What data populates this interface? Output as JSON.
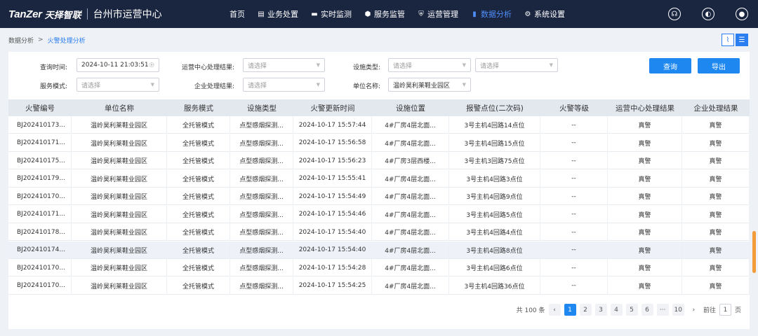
{
  "app": {
    "brand": "TanZer",
    "brand_cn": "天择智联",
    "center": "台州市运营中心"
  },
  "nav": [
    {
      "label": "首页",
      "icon": "",
      "active": false
    },
    {
      "label": "业务处置",
      "icon": "document-icon",
      "active": false
    },
    {
      "label": "实时监测",
      "icon": "monitor-icon",
      "active": false
    },
    {
      "label": "服务监管",
      "icon": "shield-icon",
      "active": false
    },
    {
      "label": "运营管理",
      "icon": "shield-check-icon",
      "active": false
    },
    {
      "label": "数据分析",
      "icon": "bar-chart-icon",
      "active": true
    },
    {
      "label": "系统设置",
      "icon": "gear-icon",
      "active": false
    }
  ],
  "breadcrumb": {
    "parent": "数据分析",
    "separator": ">",
    "current": "火警处理分析"
  },
  "filters": {
    "query_time_label": "查询时间:",
    "query_time_value": "2024-10-11 21:03:51 -",
    "center_result_label": "运营中心处理结果:",
    "facility_type_label": "设施类型:",
    "service_mode_label": "服务模式:",
    "company_result_label": "企业处理结果:",
    "unit_name_label": "单位名称:",
    "unit_name_value": "温岭昊利莱鞋业园区",
    "placeholder": "请选择",
    "search_button": "查询",
    "export_button": "导出"
  },
  "table": {
    "columns": [
      "火警编号",
      "单位名称",
      "服务模式",
      "设施类型",
      "火警更新时间",
      "设施位置",
      "报警点位(二次码)",
      "火警等级",
      "运营中心处理结果",
      "企业处理结果"
    ],
    "rows": [
      [
        "BJ202410173...",
        "温岭昊利莱鞋业园区",
        "全托管模式",
        "点型感烟探测...",
        "2024-10-17 15:57:44",
        "4#厂房4层北面...",
        "3号主机4回路14点位",
        "--",
        "真警",
        "真警"
      ],
      [
        "BJ202410171...",
        "温岭昊利莱鞋业园区",
        "全托管模式",
        "点型感烟探测...",
        "2024-10-17 15:56:58",
        "4#厂房4层北面...",
        "3号主机4回路15点位",
        "--",
        "真警",
        "真警"
      ],
      [
        "BJ202410175...",
        "温岭昊利莱鞋业园区",
        "全托管模式",
        "点型感烟探测...",
        "2024-10-17 15:56:23",
        "4#厂房3层西楼...",
        "3号主机3回路75点位",
        "--",
        "真警",
        "真警"
      ],
      [
        "BJ202410179...",
        "温岭昊利莱鞋业园区",
        "全托管模式",
        "点型感烟探测...",
        "2024-10-17 15:55:41",
        "4#厂房4层北面...",
        "3号主机4回路3点位",
        "--",
        "真警",
        "真警"
      ],
      [
        "BJ202410170...",
        "温岭昊利莱鞋业园区",
        "全托管模式",
        "点型感烟探测...",
        "2024-10-17 15:54:49",
        "4#厂房4层北面...",
        "3号主机4回路9点位",
        "--",
        "真警",
        "真警"
      ],
      [
        "BJ202410171...",
        "温岭昊利莱鞋业园区",
        "全托管模式",
        "点型感烟探测...",
        "2024-10-17 15:54:46",
        "4#厂房4层北面...",
        "3号主机4回路5点位",
        "--",
        "真警",
        "真警"
      ],
      [
        "BJ202410178...",
        "温岭昊利莱鞋业园区",
        "全托管模式",
        "点型感烟探测...",
        "2024-10-17 15:54:40",
        "4#厂房4层北面...",
        "3号主机4回路4点位",
        "--",
        "真警",
        "真警"
      ],
      [
        "BJ202410174...",
        "温岭昊利莱鞋业园区",
        "全托管模式",
        "点型感烟探测...",
        "2024-10-17 15:54:40",
        "4#厂房4层北面...",
        "3号主机4回路8点位",
        "--",
        "真警",
        "真警"
      ],
      [
        "BJ202410170...",
        "温岭昊利莱鞋业园区",
        "全托管模式",
        "点型感烟探测...",
        "2024-10-17 15:54:28",
        "4#厂房4层北面...",
        "3号主机4回路6点位",
        "--",
        "真警",
        "真警"
      ],
      [
        "BJ202410170...",
        "温岭昊利莱鞋业园区",
        "全托管模式",
        "点型感烟探测...",
        "2024-10-17 15:54:25",
        "4#厂房4层北面...",
        "3号主机4回路36点位",
        "--",
        "真警",
        "真警"
      ]
    ],
    "highlighted_row": 7
  },
  "pager": {
    "total": "共 100 条",
    "pages": [
      "1",
      "2",
      "3",
      "4",
      "5",
      "6",
      "···",
      "10"
    ],
    "current": "1",
    "goto_label": "前往",
    "goto_value": "1",
    "page_suffix": "页"
  }
}
